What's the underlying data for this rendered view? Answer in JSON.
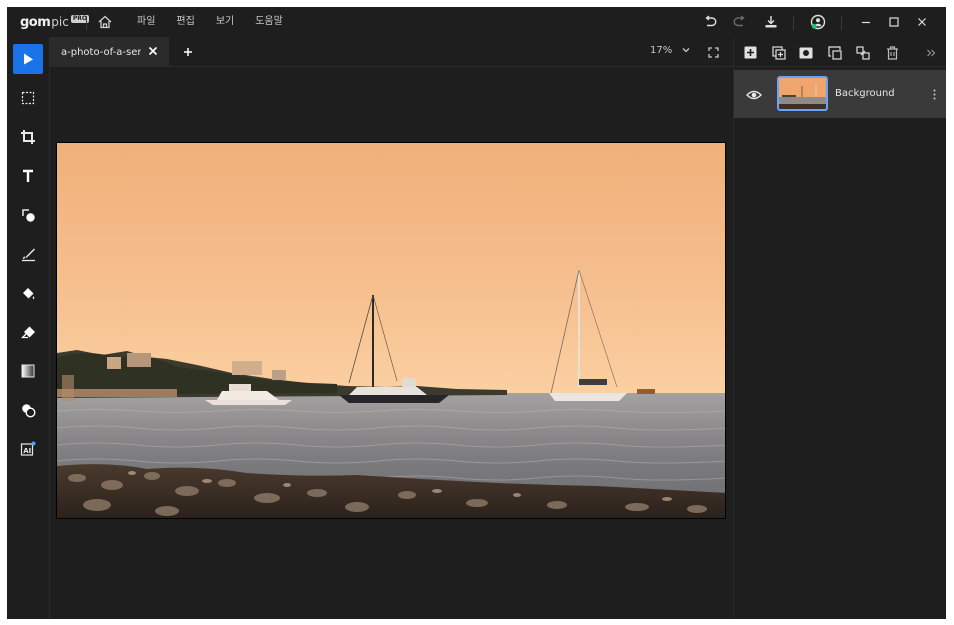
{
  "app": {
    "logo_main": "gom",
    "logo_sub": "pic",
    "logo_badge": "PRO"
  },
  "menu": {
    "items": [
      {
        "label": "파일"
      },
      {
        "label": "편집"
      },
      {
        "label": "보기"
      },
      {
        "label": "도움말"
      }
    ]
  },
  "titlebar_icons": [
    "home-icon",
    "undo-icon",
    "redo-icon",
    "download-icon",
    "account-icon",
    "minimize-icon",
    "maximize-icon",
    "close-icon"
  ],
  "tools": [
    {
      "name": "select-tool",
      "icon": "cursor-arrow-icon",
      "active": true
    },
    {
      "name": "marquee-tool",
      "icon": "marquee-icon",
      "active": false
    },
    {
      "name": "crop-tool",
      "icon": "crop-icon",
      "active": false
    },
    {
      "name": "text-tool",
      "icon": "text-icon",
      "active": false
    },
    {
      "name": "shape-tool",
      "icon": "shape-icon",
      "active": false
    },
    {
      "name": "brush-tool",
      "icon": "brush-icon",
      "active": false
    },
    {
      "name": "fill-tool",
      "icon": "paint-bucket-icon",
      "active": false
    },
    {
      "name": "eraser-tool",
      "icon": "eraser-icon",
      "active": false
    },
    {
      "name": "gradient-tool",
      "icon": "gradient-icon",
      "active": false
    },
    {
      "name": "blend-tool",
      "icon": "blend-circles-icon",
      "active": false
    },
    {
      "name": "ai-tool",
      "icon": "ai-icon",
      "active": false
    }
  ],
  "document": {
    "tab_label": "a-photo-of-a-ser...",
    "zoom_value": "17%"
  },
  "layers_panel": {
    "toolbar_icons": [
      "add-layer-icon",
      "duplicate-layer-icon",
      "mask-icon",
      "import-layer-icon",
      "link-layer-icon",
      "delete-layer-icon",
      "collapse-panel-icon"
    ],
    "layers": [
      {
        "name": "Background",
        "visible": true,
        "selected": true
      }
    ]
  },
  "colors": {
    "background": "#1e1e1e",
    "accent": "#1a73e8",
    "selected_layer": "#3a3a3a",
    "thumb_border": "#6aa3ff"
  }
}
